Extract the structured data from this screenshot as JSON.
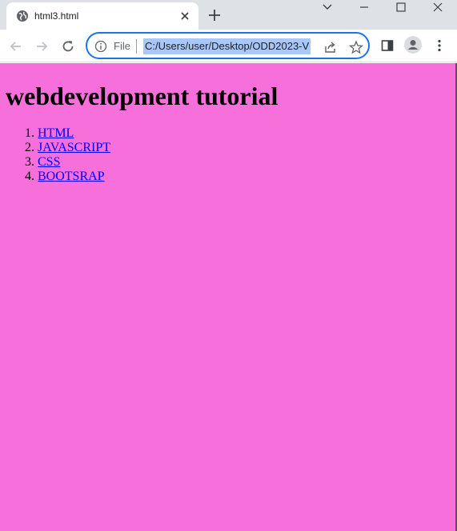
{
  "browser": {
    "tab_title": "html3.html",
    "address": {
      "scheme_label": "File",
      "url": "C:/Users/user/Desktop/ODD2023-V"
    }
  },
  "page": {
    "heading": "webdevelopment tutorial",
    "list_items": [
      {
        "label": "HTML"
      },
      {
        "label": "JAVASCRIPT"
      },
      {
        "label": "CSS"
      },
      {
        "label": "BOOTSRAP"
      }
    ],
    "background_color": "#f76fda",
    "link_color": "#0000ee"
  }
}
